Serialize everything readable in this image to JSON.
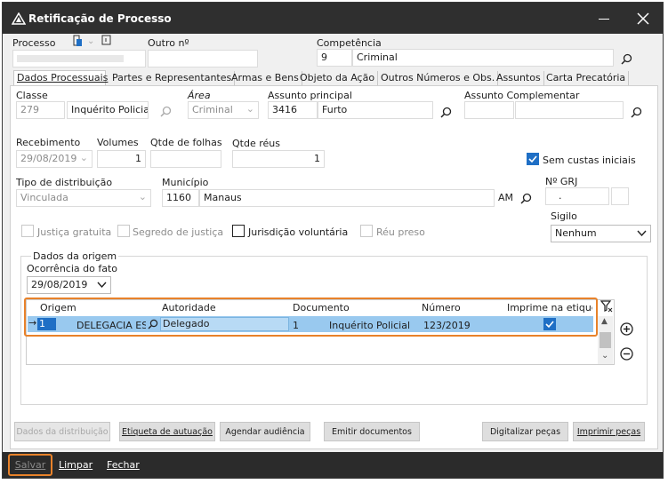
{
  "window": {
    "title": "Retificação de Processo",
    "minimize_icon": "minimize-icon",
    "close_icon": "close-icon"
  },
  "header": {
    "processo_label": "Processo",
    "outro_label": "Outro nº",
    "competencia_label": "Competência",
    "competencia_code": "9",
    "competencia_name": "Criminal"
  },
  "tabs": [
    "Dados Processuais",
    "Partes e Representantes",
    "Armas e Bens",
    "Objeto da Ação",
    "Outros Números e Obs.",
    "Assuntos",
    "Carta Precatória"
  ],
  "form": {
    "classe_label": "Classe",
    "classe_code": "279",
    "classe_name": "Inquérito Policial",
    "area_label": "Área",
    "area_value": "Criminal",
    "assunto_label": "Assunto principal",
    "assunto_code": "3416",
    "assunto_name": "Furto",
    "assunto_comp_label": "Assunto Complementar",
    "recebimento_label": "Recebimento",
    "recebimento_value": "29/08/2019",
    "volumes_label": "Volumes",
    "volumes_value": "1",
    "folhas_label": "Qtde de folhas",
    "reus_label": "Qtde réus",
    "reus_value": "1",
    "sem_custas_label": "Sem custas iniciais",
    "tipo_dist_label": "Tipo de distribuição",
    "tipo_dist_value": "Vinculada",
    "municipio_label": "Município",
    "municipio_code": "1160",
    "municipio_name": "Manaus",
    "municipio_uf": "AM",
    "grj_label": "Nº GRJ",
    "grj_value": ".",
    "sigilo_label": "Sigilo",
    "sigilo_value": "Nenhum",
    "justica_gratuita": "Justiça gratuita",
    "segredo_justica": "Segredo de justiça",
    "jurisdicao_voluntaria": "Jurisdição voluntária",
    "reu_preso": "Réu preso"
  },
  "origem": {
    "group_label": "Dados da origem",
    "ocorrencia_label": "Ocorrência do fato",
    "ocorrencia_value": "29/08/2019",
    "columns": [
      "Origem",
      "Autoridade",
      "Documento",
      "Número",
      "Imprime na etiquet"
    ],
    "row": {
      "origem_code": "1",
      "origem_name": "DELEGACIA ESP",
      "autoridade": "Delegado",
      "documento_code": "1",
      "documento_name": "Inquérito Policial",
      "numero": "123/2019"
    }
  },
  "buttons": {
    "dados_dist": "Dados da distribuição",
    "etiqueta": "Etiqueta de autuação",
    "agendar": "Agendar audiência",
    "emitir": "Emitir documentos",
    "digitalizar": "Digitalizar peças",
    "imprimir": "Imprimir peças"
  },
  "footer": {
    "salvar": "Salvar",
    "limpar": "Limpar",
    "fechar": "Fechar"
  },
  "colors": {
    "titlebar": "#2f2f2f",
    "highlight": "#e8822a",
    "selection": "#99c9ef",
    "check": "#1f6fc5"
  }
}
